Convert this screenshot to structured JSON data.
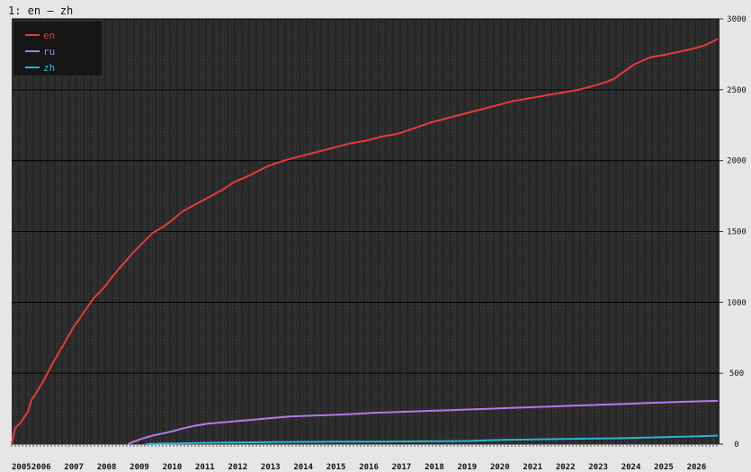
{
  "window": {
    "title": "1: en – zh"
  },
  "chart_data": {
    "type": "line",
    "title": "1: en – zh",
    "xlabel": "",
    "ylabel": "",
    "ylim": [
      0,
      3000
    ],
    "xlim": [
      2005.0,
      2026.6
    ],
    "grid": true,
    "legend_position": "top-left",
    "y_ticks": [
      0,
      500,
      1000,
      1500,
      2000,
      2500,
      3000
    ],
    "x_year_labels": [
      "2005",
      "2006",
      "2007",
      "2008",
      "2009",
      "2010",
      "2011",
      "2012",
      "2013",
      "2014",
      "2015",
      "2016",
      "2017",
      "2018",
      "2019",
      "2020",
      "2021",
      "2022",
      "2023",
      "2024",
      "2025",
      "2026"
    ],
    "x_year_positions": [
      2005.0,
      2005.6,
      2006.6,
      2007.6,
      2008.6,
      2009.6,
      2010.6,
      2011.6,
      2012.6,
      2013.6,
      2014.6,
      2015.6,
      2016.6,
      2017.6,
      2018.6,
      2019.6,
      2020.6,
      2021.6,
      2022.6,
      2023.6,
      2024.6,
      2025.6
    ],
    "series": [
      {
        "name": "en",
        "color": "#e83a3a",
        "x": [
          2005.0,
          2005.1,
          2005.3,
          2005.5,
          2005.6,
          2005.8,
          2006.0,
          2006.3,
          2006.6,
          2006.9,
          2007.2,
          2007.5,
          2007.8,
          2008.1,
          2008.4,
          2008.7,
          2009.0,
          2009.3,
          2009.6,
          2009.9,
          2010.2,
          2010.6,
          2011.0,
          2011.4,
          2011.8,
          2012.3,
          2012.8,
          2013.3,
          2013.8,
          2014.3,
          2014.8,
          2015.3,
          2015.8,
          2016.3,
          2016.8,
          2017.3,
          2017.8,
          2018.3,
          2018.8,
          2019.3,
          2019.8,
          2020.3,
          2020.8,
          2021.3,
          2021.8,
          2022.3,
          2022.8,
          2023.2,
          2023.4,
          2023.7,
          2024.0,
          2024.5,
          2025.0,
          2025.4,
          2025.8,
          2026.1,
          2026.4,
          2026.55
        ],
        "y": [
          0,
          110,
          160,
          230,
          310,
          380,
          460,
          590,
          710,
          830,
          930,
          1030,
          1100,
          1190,
          1270,
          1350,
          1420,
          1490,
          1530,
          1580,
          1640,
          1690,
          1740,
          1790,
          1850,
          1900,
          1960,
          2000,
          2030,
          2060,
          2090,
          2120,
          2140,
          2170,
          2190,
          2230,
          2270,
          2300,
          2330,
          2360,
          2390,
          2420,
          2440,
          2460,
          2480,
          2500,
          2530,
          2560,
          2580,
          2630,
          2680,
          2730,
          2750,
          2770,
          2790,
          2810,
          2840,
          2860
        ]
      },
      {
        "name": "ru",
        "color": "#b07be8",
        "x": [
          2008.55,
          2008.7,
          2009.0,
          2009.3,
          2009.6,
          2009.9,
          2010.2,
          2010.6,
          2011.0,
          2011.5,
          2012.0,
          2012.5,
          2013.0,
          2013.5,
          2014.0,
          2014.6,
          2015.2,
          2015.6,
          2016.0,
          2016.6,
          2017.2,
          2017.8,
          2018.4,
          2019.0,
          2019.6,
          2020.2,
          2020.8,
          2021.4,
          2022.0,
          2022.6,
          2023.2,
          2023.8,
          2024.4,
          2025.0,
          2025.6,
          2026.0,
          2026.55
        ],
        "y": [
          0,
          15,
          40,
          60,
          75,
          90,
          110,
          130,
          145,
          155,
          165,
          175,
          185,
          195,
          200,
          205,
          210,
          215,
          220,
          225,
          230,
          235,
          240,
          245,
          250,
          255,
          260,
          265,
          270,
          275,
          280,
          285,
          290,
          295,
          300,
          302,
          305
        ]
      },
      {
        "name": "zh",
        "color": "#26b7d4",
        "x": [
          2009.1,
          2009.5,
          2010.0,
          2010.6,
          2011.2,
          2012.0,
          2013.0,
          2014.0,
          2015.0,
          2016.0,
          2017.0,
          2018.0,
          2019.0,
          2019.5,
          2020.0,
          2020.6,
          2021.2,
          2021.8,
          2022.4,
          2023.0,
          2023.6,
          2024.2,
          2024.8,
          2025.4,
          2026.0,
          2026.55
        ],
        "y": [
          0,
          3,
          5,
          8,
          10,
          12,
          14,
          16,
          17,
          18,
          19,
          20,
          22,
          27,
          30,
          32,
          34,
          36,
          38,
          40,
          42,
          45,
          48,
          52,
          55,
          60
        ]
      }
    ]
  }
}
